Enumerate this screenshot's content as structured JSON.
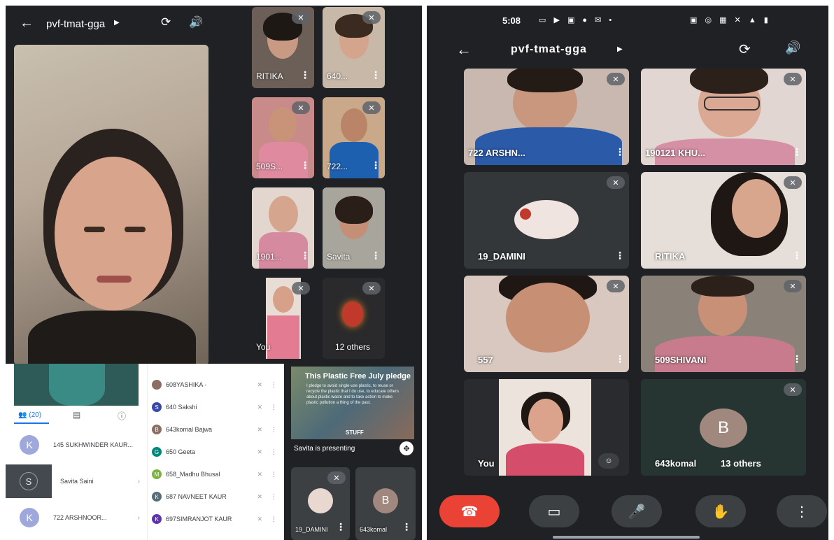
{
  "left_screen": {
    "meeting_code": "pvf-tmat-gga",
    "tiles": [
      {
        "name": "RITIKA"
      },
      {
        "name": "640..."
      },
      {
        "name": "509S..."
      },
      {
        "name": "722..."
      },
      {
        "name": "1901..."
      },
      {
        "name": "Savita"
      },
      {
        "name": "You"
      },
      {
        "name": "12 others"
      }
    ]
  },
  "participants_panel": {
    "tab_people_count": "(20)",
    "people": [
      {
        "initial": "K",
        "name": "145 SUKHWINDER KAUR..."
      },
      {
        "initial": "S",
        "name": "Savita Saini"
      },
      {
        "initial": "K",
        "name": "722 ARSHNOOR..."
      }
    ]
  },
  "participant_list": [
    {
      "initial": "",
      "name": "608YASHIKA -",
      "color": "#8d6e63"
    },
    {
      "initial": "S",
      "name": "640 Sakshi",
      "color": "#3949ab"
    },
    {
      "initial": "B",
      "name": "643komal Bajwa",
      "color": "#8d6e63"
    },
    {
      "initial": "G",
      "name": "650 Geeta",
      "color": "#00897b"
    },
    {
      "initial": "M",
      "name": "658_Madhu Bhusal",
      "color": "#7cb342"
    },
    {
      "initial": "K",
      "name": "687 NAVNEET KAUR",
      "color": "#546e7a"
    },
    {
      "initial": "K",
      "name": "697SIMRANJOT KAUR",
      "color": "#5e35b1"
    }
  ],
  "presentation": {
    "title": "This Plastic Free July pledge",
    "body": "I pledge to avoid single-use plastic, to reuse or recycle the plastic that I do use, to educate others about plastic waste and to take action to make plastic pollution a thing of the past.",
    "stamp": "STUFF",
    "presenting_label": "Savita is presenting",
    "small_tiles": [
      {
        "name": "19_DAMINI"
      },
      {
        "name": "643komal",
        "initial": "B"
      }
    ]
  },
  "right_screen": {
    "status_time": "5:08",
    "meeting_code": "pvf-tmat-gga",
    "tiles": [
      {
        "name": "722 ARSHN..."
      },
      {
        "name": "190121 KHU..."
      },
      {
        "name": "19_DAMINI"
      },
      {
        "name": "RITIKA"
      },
      {
        "name": "557"
      },
      {
        "name": "509SHIVANI"
      },
      {
        "name": "You"
      },
      {
        "name": "643komal",
        "initial": "B",
        "others": "13 others"
      }
    ],
    "colors": {
      "end_call": "#ea4335",
      "bg": "#202124"
    }
  }
}
